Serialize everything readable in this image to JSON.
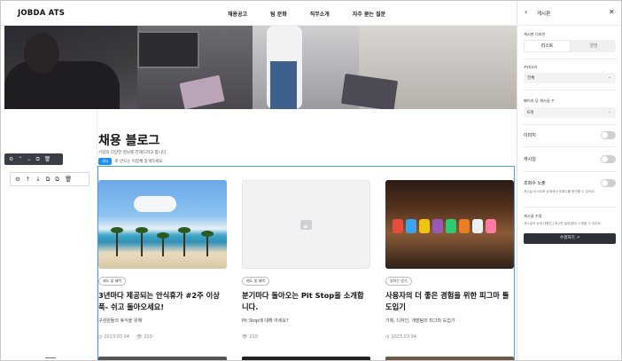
{
  "nav": {
    "logo": "JOBDA ATS",
    "links": [
      "채용공고",
      "팀 문화",
      "직무소개",
      "자주 묻는 질문"
    ]
  },
  "blog": {
    "title": "채용 블로그",
    "subtitle": "기업의 다양한 정보를 전해드려고 합니다.",
    "tag": "게시",
    "subtitle2": "로 만으는 이잡체 맞게하세요."
  },
  "toolbar_dark": [
    "⚙",
    "⌃",
    "⌄",
    "⧉",
    "🗑"
  ],
  "toolbar_light": [
    "⚙",
    "↑",
    "↓",
    "⧉",
    "⧉",
    "🗑"
  ],
  "cards": [
    {
      "category": "제도 및 혜택",
      "title": "3년마다 제공되는 안식휴가 #2주 이상 푹- 쉬고 돌아오세요!",
      "desc": "구성원들의 휴식을 위해",
      "date": "2023.03.04",
      "views": "210"
    },
    {
      "category": "제도 및 혜택",
      "title": "분기마다 돌아오는 Pit Stop을 소개합니다.",
      "desc": "Pit Stop에 대해 아세요?",
      "date": "",
      "views": "210"
    },
    {
      "category": "일하는 방식",
      "title": "사용자의 더 좋은 경험을 위한 피그마 툴 도입기",
      "desc": "기획, 디자인, 개발팀의 피그마 도입기",
      "date": "2023.03.04",
      "views": ""
    }
  ],
  "panel": {
    "title": "게시판",
    "layout_label": "게시판 디자인",
    "layout_options": [
      "리스트",
      "앨범"
    ],
    "category_label": "카테고리",
    "category_value": "전체",
    "per_page_label": "페이지 당 게시글 수",
    "per_page_value": "6개",
    "toggles": [
      {
        "label": "이미지",
        "note": ""
      },
      {
        "label": "게시일",
        "note": ""
      },
      {
        "label": "조회수 노출",
        "note": "게시글 리스트와 상세에서 조회수를 확인할 수 있어요."
      }
    ],
    "edit_label": "게시글 수정",
    "edit_note": "게시글의 상세 내용은 [게시판 설정]에서 수정할 수 있어요.",
    "edit_button": "수정하기"
  },
  "colors": {
    "accent_blue": "#1f8ef0",
    "selection": "#4f9ae8",
    "dark_button": "#2e3138"
  }
}
